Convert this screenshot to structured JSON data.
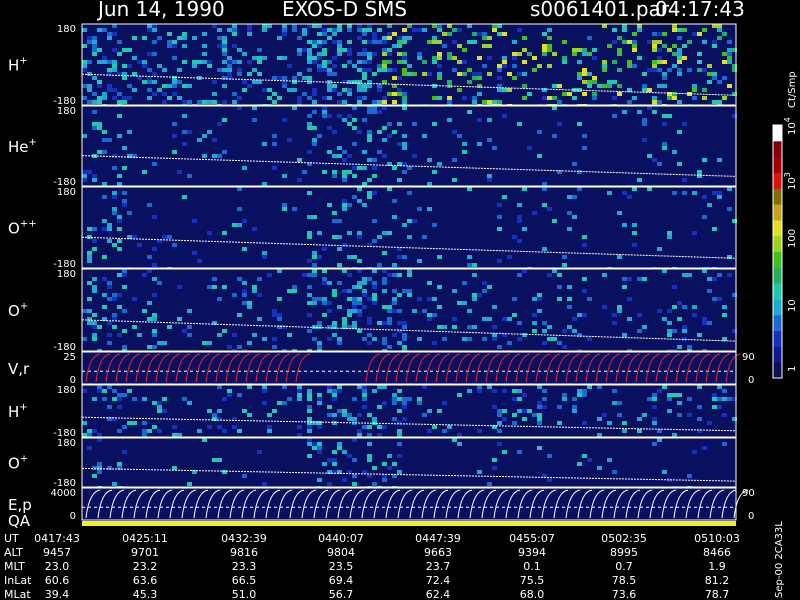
{
  "header": {
    "date": "Jun 14, 1990",
    "instrument": "EXOS-D SMS",
    "file": "s0061401.par",
    "time": "04:17:43"
  },
  "chart_data": {
    "type": "heatmap",
    "panels": [
      {
        "label": "H",
        "sup": "+",
        "ymax": "180",
        "ymin": "-180",
        "kind": "spectrogram",
        "activity": "high"
      },
      {
        "label": "He",
        "sup": "+",
        "ymax": "180",
        "ymin": "-180",
        "kind": "spectrogram",
        "activity": "low"
      },
      {
        "label": "O",
        "sup": "++",
        "ymax": "180",
        "ymin": "-180",
        "kind": "spectrogram",
        "activity": "low"
      },
      {
        "label": "O",
        "sup": "+",
        "ymax": "180",
        "ymin": "-180",
        "kind": "spectrogram",
        "activity": "medium"
      },
      {
        "label": "V,r",
        "sup": "",
        "ymax": "25",
        "ymin": "0",
        "rmax": "90",
        "rmin": "0",
        "kind": "line"
      },
      {
        "label": "H",
        "sup": "+",
        "ymax": "180",
        "ymin": "-180",
        "kind": "spectrogram",
        "activity": "medium"
      },
      {
        "label": "O",
        "sup": "+",
        "ymax": "180",
        "ymin": "-180",
        "kind": "spectrogram",
        "activity": "low"
      },
      {
        "label": "E,p",
        "sup": "",
        "ymax": "4000",
        "ymin": "0",
        "rmax": "90",
        "rmin": "0",
        "kind": "line"
      }
    ],
    "qa_label": "QA",
    "colorbar": {
      "unit": "Ct/Smp",
      "tick_labels": [
        "1",
        "10",
        "100",
        "10",
        "10"
      ],
      "tick_sups": [
        "",
        "",
        "",
        "3",
        "4"
      ],
      "colors": [
        "#0a1050",
        "#101a90",
        "#1830c0",
        "#1a6ad0",
        "#20a8d0",
        "#20c8b0",
        "#20b060",
        "#40c020",
        "#a0d020",
        "#e0e020",
        "#c8a020",
        "#807000",
        "#e01010",
        "#a00000",
        "#800010",
        "#ffffff"
      ]
    },
    "time_axis": {
      "rows": [
        {
          "name": "UT",
          "values": [
            "0417:43",
            "0425:11",
            "0432:39",
            "0440:07",
            "0447:39",
            "0455:07",
            "0502:35",
            "0510:03"
          ]
        },
        {
          "name": "ALT",
          "values": [
            "9457",
            "9701",
            "9816",
            "9804",
            "9663",
            "9394",
            "8995",
            "8466"
          ]
        },
        {
          "name": "MLT",
          "values": [
            "23.0",
            "23.2",
            "23.3",
            "23.5",
            "23.7",
            "0.1",
            "0.7",
            "1.9"
          ]
        },
        {
          "name": "InLat",
          "values": [
            "60.6",
            "63.6",
            "66.5",
            "69.4",
            "72.4",
            "75.5",
            "78.5",
            "81.2"
          ]
        },
        {
          "name": "MLat",
          "values": [
            "39.4",
            "45.3",
            "51.0",
            "56.7",
            "62.4",
            "68.0",
            "73.6",
            "78.7"
          ]
        }
      ]
    },
    "side_note": "Sep-00 2CA33L"
  }
}
